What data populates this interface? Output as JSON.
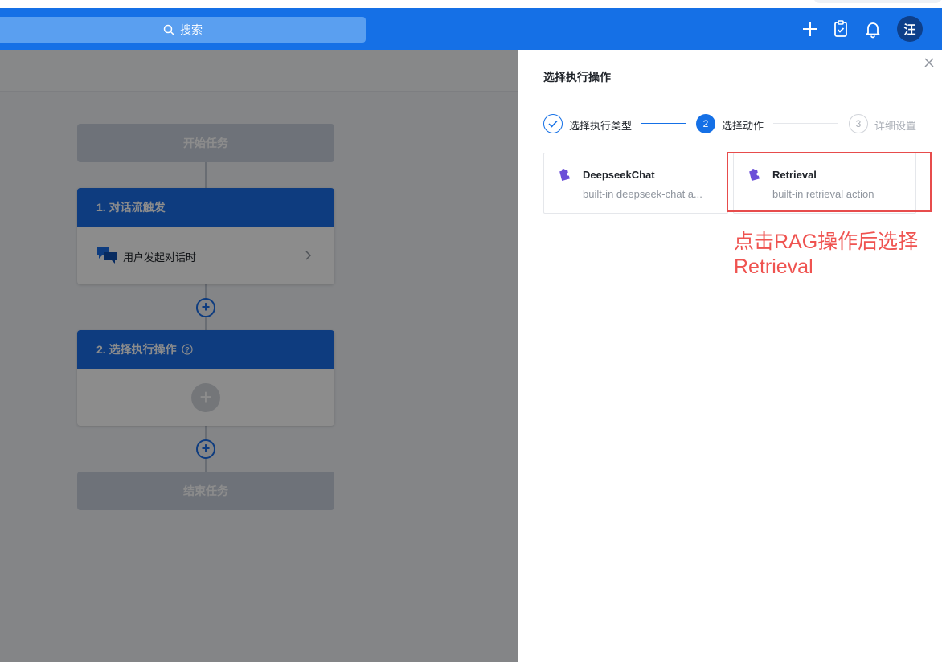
{
  "header": {
    "search_label": "搜索",
    "avatar_text": "汪",
    "icons": [
      "plus-icon",
      "clipboard-check-icon",
      "bell-icon"
    ]
  },
  "flow": {
    "start": "开始任务",
    "trigger_title": "1. 对话流触发",
    "trigger_item": "用户发起对话时",
    "action_title": "2. 选择执行操作",
    "end": "结束任务"
  },
  "drawer": {
    "title": "选择执行操作",
    "steps": [
      {
        "number": "",
        "label": "选择执行类型",
        "status": "done"
      },
      {
        "number": "2",
        "label": "选择动作",
        "status": "active"
      },
      {
        "number": "3",
        "label": "详细设置",
        "status": "pending"
      }
    ],
    "actions": [
      {
        "name": "DeepseekChat",
        "description": "built-in deepseek-chat a..."
      },
      {
        "name": "Retrieval",
        "description": "built-in retrieval action"
      }
    ]
  },
  "annotation": {
    "line1": "点击RAG操作后选择",
    "line2": "Retrieval"
  },
  "colors": {
    "primary": "#1570e6",
    "annotation_red": "#ef5350",
    "action_icon": "#6b4fd8"
  }
}
